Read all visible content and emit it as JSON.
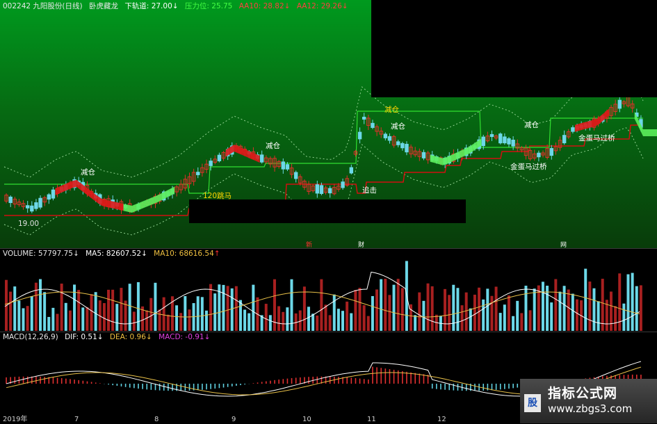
{
  "main": {
    "stock_label": "002242 九阳股份(日线)",
    "indicator": "卧虎藏龙",
    "lower_track_label": "下轨道: 27.00",
    "lower_track_arrow": "↓",
    "pressure_label": "压力位: 25.75",
    "aa10_label": "AA10: 28.82",
    "aa10_arrow": "↓",
    "aa12_label": "AA12: 29.26",
    "aa12_arrow": "↓",
    "low_price_label": "19.00",
    "annotations": [
      "减仓",
      "减仓",
      "减仓",
      "减仓",
      "减仓",
      "120跳马",
      "追击",
      "金蛋马过桥",
      "金蛋马过桥"
    ],
    "bottom_chars": [
      "新",
      "财",
      "网"
    ]
  },
  "volume": {
    "vol_label": "VOLUME: 57797.75",
    "vol_arrow": "↓",
    "ma5_label": "MA5: 82607.52",
    "ma5_arrow": "↓",
    "ma10_label": "MA10: 68616.54",
    "ma10_arrow": "↑"
  },
  "macd": {
    "name_label": "MACD(12,26,9)",
    "dif_label": "DIF: 0.51",
    "dif_arrow": "↓",
    "dea_label": "DEA: 0.96",
    "dea_arrow": "↓",
    "macd_label": "MACD: -0.91",
    "macd_arrow": "↓"
  },
  "xaxis": {
    "labels": [
      "2019年",
      "7",
      "8",
      "9",
      "10",
      "11",
      "12"
    ]
  },
  "watermark": {
    "title": "指标公式网",
    "url": "www.zbgs3.com",
    "logo": "股"
  },
  "colors": {
    "up": "#e0302a",
    "down": "#6cd8e8",
    "ribbon_up": "#e01818",
    "ribbon_down": "#5cf05c",
    "ma5": "#ffffff",
    "ma10": "#e8c048"
  },
  "chart_data": {
    "type": "candlestick",
    "title": "九阳股份(日线)",
    "xlabel": "",
    "ylabel": "",
    "x_labels": [
      "2019年",
      "7",
      "8",
      "9",
      "10",
      "11",
      "12"
    ],
    "annotations": {
      "lower_track": 27.0,
      "pressure": 25.75,
      "aa10": 28.82,
      "aa12": 29.26,
      "min_price": 19.0
    },
    "volume": {
      "last": 57797.75,
      "ma5": 82607.52,
      "ma10": 68616.54
    },
    "macd": {
      "params": [
        12,
        26,
        9
      ],
      "dif": 0.51,
      "dea": 0.96,
      "macd": -0.91
    }
  }
}
